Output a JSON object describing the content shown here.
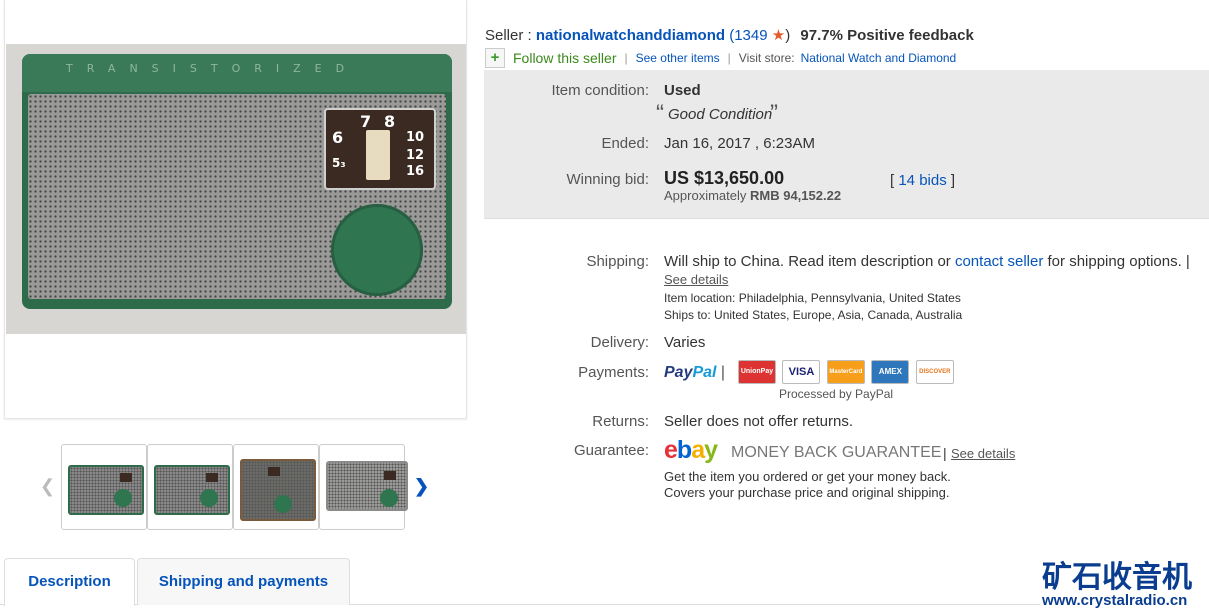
{
  "seller": {
    "prefix": "Seller :",
    "name": "nationalwatchanddiamond",
    "score": "(1349",
    "score_close": ")",
    "feedback": "97.7% Positive feedback",
    "follow": "Follow this seller",
    "see_other": "See other items",
    "visit_label": "Visit store:",
    "store_name": "National Watch and Diamond"
  },
  "radio_image": {
    "top_text": "TRANSISTORIZED",
    "dial_numbers": [
      "7",
      "8",
      "6",
      "10",
      "12",
      "5₃",
      "16"
    ]
  },
  "item": {
    "condition_label": "Item condition:",
    "condition_value": "Used",
    "condition_note_open": "“",
    "condition_note": "Good Condition",
    "condition_note_close": "”",
    "ended_label": "Ended:",
    "ended_value": "Jan 16, 2017 , 6:23AM",
    "bid_label": "Winning bid:",
    "bid_value": "US $13,650.00",
    "approx_label": "Approximately",
    "approx_value": "RMB 94,152.22",
    "bids_open": "[",
    "bids_link": "14 bids",
    "bids_close": "]"
  },
  "shipping": {
    "label": "Shipping:",
    "text_a": "Will ship to China. Read item description or",
    "contact_link": "contact seller",
    "text_b": "for shipping options. |",
    "see_details": "See details",
    "location_label": "Item location:",
    "location_value": "Philadelphia, Pennsylvania, United States",
    "ships_label": "Ships to:",
    "ships_value": "United States, Europe, Asia, Canada, Australia"
  },
  "delivery": {
    "label": "Delivery:",
    "value": "Varies"
  },
  "payments": {
    "label": "Payments:",
    "paypal_a": "Pay",
    "paypal_b": "Pal",
    "cards": [
      "UnionPay",
      "VISA",
      "MasterCard",
      "AMEX",
      "DISCOVER"
    ],
    "processed": "Processed by PayPal"
  },
  "returns": {
    "label": "Returns:",
    "value": "Seller does not offer returns."
  },
  "guarantee": {
    "label": "Guarantee:",
    "ebay_e": "e",
    "ebay_b": "b",
    "ebay_a": "a",
    "ebay_y": "y",
    "mbg": "MONEY BACK GUARANTEE",
    "sep": "|",
    "see_details": "See details",
    "line1": "Get the item you ordered or get your money back.",
    "line2": "Covers your purchase price and original shipping."
  },
  "tabs": {
    "description": "Description",
    "shipping": "Shipping and payments"
  },
  "watermark": {
    "title": "矿石收音机",
    "url": "www.crystalradio.cn"
  },
  "colors": {
    "link": "#0654ba",
    "star": "#e45a2a",
    "radio_green": "#2d6b4a"
  }
}
